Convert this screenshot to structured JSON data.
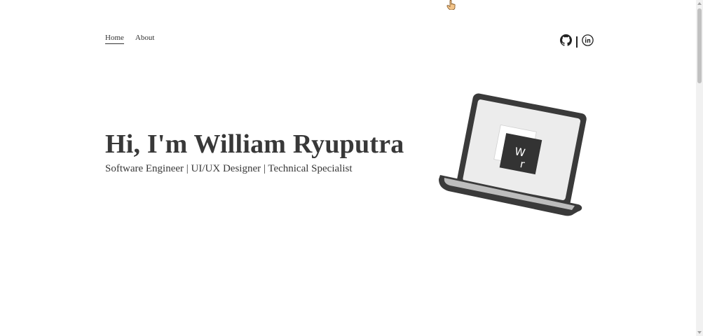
{
  "nav": {
    "items": [
      {
        "label": "Home",
        "active": true
      },
      {
        "label": "About",
        "active": false
      }
    ]
  },
  "socials": {
    "icons": [
      "github-icon",
      "linkedin-icon"
    ]
  },
  "hero": {
    "title": "Hi, I'm William Ryuputra",
    "subtitle": "Software Engineer | UI/UX Designer | Technical Specialist"
  },
  "laptop": {
    "logo_text_1": "W",
    "logo_text_2": "r"
  },
  "colors": {
    "text": "#383838",
    "laptop_frame": "#3a3a3a",
    "laptop_screen": "#ececec",
    "logo_tile": "#333333"
  }
}
